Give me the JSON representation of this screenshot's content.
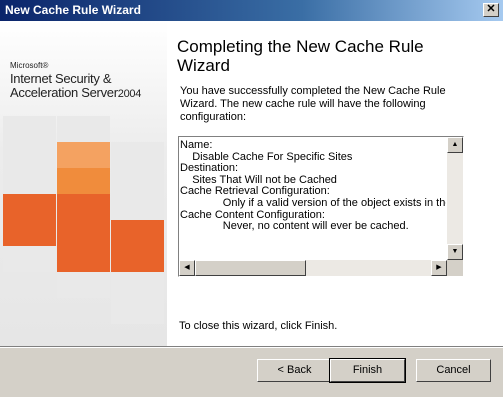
{
  "window": {
    "title": "New Cache Rule Wizard",
    "close_glyph": "✕"
  },
  "branding": {
    "small": "Microsoft®",
    "line1": "Internet Security &",
    "line2": "Acceleration Server",
    "year": "2004",
    "tile_colors": [
      "#e8632a",
      "#f08c3c",
      "#f4a261",
      "#e9e9e9"
    ]
  },
  "page": {
    "heading": "Completing the New Cache Rule Wizard",
    "intro": "You have successfully completed the New Cache Rule Wizard. The new cache rule will have the following configuration:",
    "summary_lines": [
      "Name:",
      "    Disable Cache For Specific Sites",
      "Destination:",
      "    Sites That Will not be Cached",
      "Cache Retrieval Configuration:",
      "              Only if a valid version of the object exists in the",
      "Cache Content Configuration:",
      "              Never, no content will ever be cached."
    ],
    "close_instruction": "To close this wizard, click Finish."
  },
  "buttons": {
    "back": "< Back",
    "finish": "Finish",
    "cancel": "Cancel"
  },
  "icons": {
    "scroll_up": "▲",
    "scroll_down": "▼",
    "scroll_left": "◀",
    "scroll_right": "▶"
  }
}
